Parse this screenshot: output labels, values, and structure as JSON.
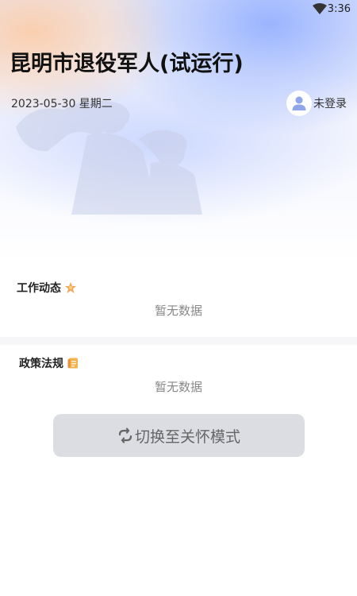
{
  "status_bar": {
    "time": "3:36",
    "wifi_icon": "wifi-icon"
  },
  "header": {
    "title": "昆明市退役军人(试运行)",
    "date": "2023-05-30 星期二",
    "login_status": "未登录",
    "avatar_icon": "user-avatar-icon"
  },
  "sections": [
    {
      "title": "工作动态",
      "icon": "star-badge-icon",
      "empty_text": "暂无数据"
    },
    {
      "title": "政策法规",
      "icon": "document-icon",
      "empty_text": "暂无数据"
    }
  ],
  "switch_button": {
    "label": "切换至关怀模式",
    "icon": "refresh-swap-icon"
  },
  "colors": {
    "button_bg": "#dcdde3",
    "button_text": "#666666",
    "empty_text": "#888888",
    "accent_blue": "#8caaff",
    "accent_peach": "#ffc496"
  }
}
